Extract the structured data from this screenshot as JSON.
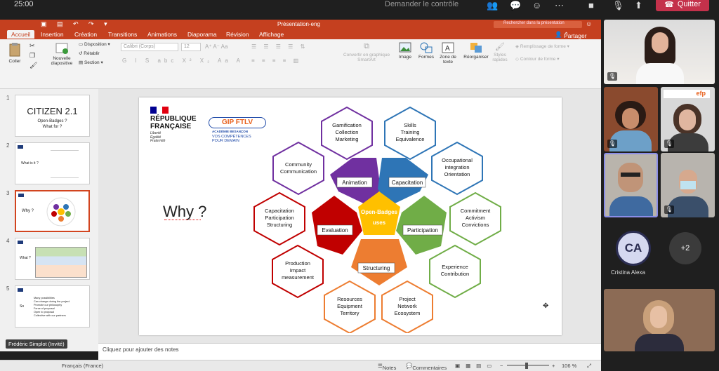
{
  "meeting": {
    "time": "25:00",
    "ask_control": "Demander le contrôle",
    "quit": "Quitter"
  },
  "ppt": {
    "doc_title": "Présentation-eng",
    "search_placeholder": "Rechercher dans la présentation",
    "tabs": [
      "Accueil",
      "Insertion",
      "Création",
      "Transitions",
      "Animations",
      "Diaporama",
      "Révision",
      "Affichage"
    ],
    "share": "Partager",
    "ribbon": {
      "paste": "Coller",
      "new_slide": "Nouvelle diapositive",
      "layout": "Disposition",
      "reset": "Rétablir",
      "section": "Section",
      "font": "Calibri (Corps)",
      "font_size": "12",
      "smartart": "Convertir en graphique SmartArt",
      "image": "Image",
      "shapes": "Formes",
      "textbox": "Zone de texte",
      "arrange": "Réorganiser",
      "quick_styles": "Styles rapides",
      "shape_fill": "Remplissage de forme",
      "shape_outline": "Contour de forme"
    },
    "thumbnails": [
      {
        "num": "1",
        "title": "CITIZEN 2.1",
        "line1": "Open-Badges ?",
        "line2": "What for ?"
      },
      {
        "num": "2",
        "title": "What is it ?"
      },
      {
        "num": "3",
        "title": "Why ?"
      },
      {
        "num": "4",
        "title": "What ?"
      },
      {
        "num": "5",
        "title": "So",
        "bullets": [
          "Many possibilities",
          "Can change during the project",
          "Promote our philosophy",
          "Force of proposal",
          "Open to proposal",
          "Collective with our partners"
        ]
      }
    ],
    "notes_placeholder": "Cliquez pour ajouter des notes",
    "status": {
      "language": "Français (France)",
      "notes": "Notes",
      "comments": "Commentaires",
      "zoom": "106 %"
    }
  },
  "slide": {
    "rf_line1": "RÉPUBLIQUE",
    "rf_line2": "FRANÇAISE",
    "rf_motto": [
      "Liberté",
      "Égalité",
      "Fraternité"
    ],
    "gip_title": "GIP FTLV",
    "gip_sub": "ACADÉMIE BESANÇON",
    "gip_slogan1": "VOS COMPÉTENCES",
    "gip_slogan2": "POUR DEMAIN",
    "why": "Why ?",
    "center": [
      "Open-Badges",
      "uses"
    ],
    "categories": {
      "animation": "Animation",
      "capacitation": "Capacitation",
      "participation": "Participation",
      "structuring": "Structuring",
      "evaluation": "Evaluation"
    },
    "outer": {
      "gamification": [
        "Gamification",
        "Collection",
        "Marketing"
      ],
      "skills": [
        "Skills",
        "Training",
        "Equivalence"
      ],
      "occupational": [
        "Occupational",
        "integration",
        "Orientation"
      ],
      "commitment": [
        "Commitment",
        "Activism",
        "Convictions"
      ],
      "experience": [
        "Experience",
        "Contribution"
      ],
      "project": [
        "Project",
        "Network",
        "Ecosystem"
      ],
      "resources": [
        "Resources",
        "Equipment",
        "Territory"
      ],
      "production": [
        "Production",
        "Impact",
        "measurement"
      ],
      "capacitation": [
        "Capacitation",
        "Participation",
        "Structuring"
      ],
      "community": [
        "Community",
        "Communication"
      ]
    },
    "colors": {
      "animation": "#7030a0",
      "capacitation": "#2e75b6",
      "participation": "#70ad47",
      "structuring": "#ed7d31",
      "evaluation": "#c00000",
      "center": "#ffc000"
    }
  },
  "participants": {
    "presenter_name": "Frédéric Simplot (Invité)",
    "avatar_initials": "CA",
    "avatar_name": "Cristina Alexa",
    "more": "+2",
    "efp": "efp"
  }
}
